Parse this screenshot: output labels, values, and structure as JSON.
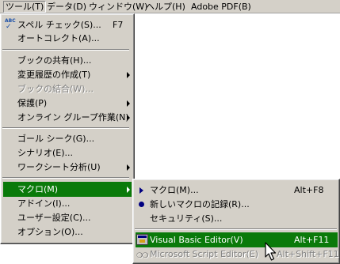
{
  "menubar": {
    "items": [
      "ツール(T)",
      "データ(D)",
      "ウィンドウ(W)",
      "ヘルプ(H)",
      "Adobe PDF(B)"
    ]
  },
  "tools_menu": {
    "spelling": {
      "label": "スペル チェック(S)...",
      "shortcut": "F7",
      "icon": "abc-check-icon"
    },
    "autocorrect": "オートコレクト(A)...",
    "share": "ブックの共有(H)...",
    "track_changes": "変更履歴の作成(T)",
    "merge": "ブックの結合(W)...",
    "protection": "保護(P)",
    "online_collab": "オンライン グループ作業(N)",
    "goal_seek": "ゴール シーク(G)...",
    "scenarios": "シナリオ(E)...",
    "auditing": "ワークシート分析(U)",
    "macro": "マクロ(M)",
    "addins": "アドイン(I)...",
    "customize": "ユーザー設定(C)...",
    "options": "オプション(O)..."
  },
  "macro_submenu": {
    "macros": {
      "label": "マクロ(M)...",
      "shortcut": "Alt+F8"
    },
    "record": {
      "label": "新しいマクロの記録(R)..."
    },
    "security": {
      "label": "セキュリティ(S)..."
    },
    "vbe": {
      "label": "Visual Basic Editor(V)",
      "shortcut": "Alt+F11"
    },
    "mse": {
      "label": "Microsoft Script Editor(E)",
      "shortcut": "Alt+Shift+F11"
    }
  },
  "colors": {
    "highlight": "#0a7a0a",
    "menu_bg": "#d4d0c8",
    "icon_blue": "#000080"
  }
}
